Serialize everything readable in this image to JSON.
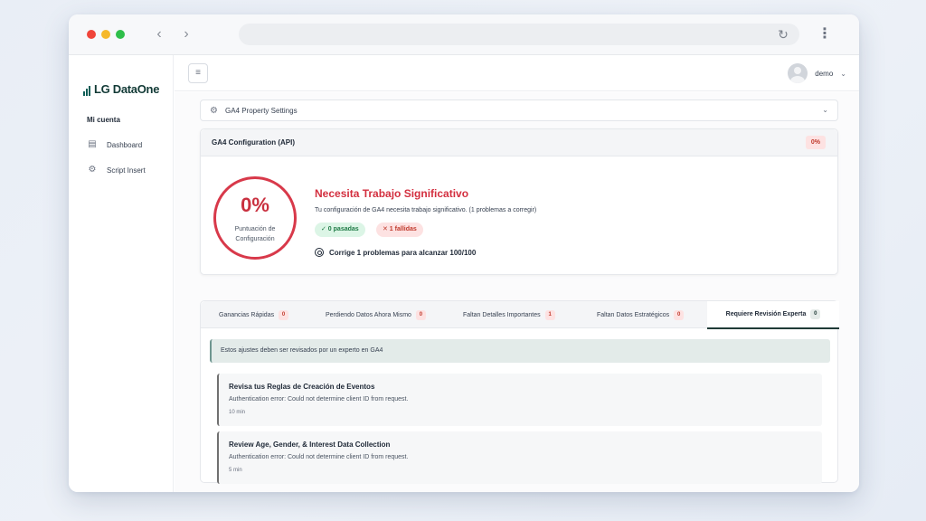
{
  "brand": {
    "name": "LG DataOne"
  },
  "sidebar": {
    "section_label": "Mi cuenta",
    "items": [
      {
        "label": "Dashboard",
        "icon": "table-icon"
      },
      {
        "label": "Script Insert",
        "icon": "gear-icon"
      }
    ]
  },
  "topbar": {
    "user_name": "demo"
  },
  "property_settings": {
    "label": "GA4 Property Settings"
  },
  "config": {
    "title": "GA4 Configuration (API)",
    "badge": "0%",
    "score_value": "0%",
    "score_label": "Puntuación de Configuración",
    "status_title": "Necesita Trabajo Significativo",
    "status_desc": "Tu configuración de GA4 necesita trabajo significativo. (1 problemas a corregir)",
    "passed_label": "✓ 0 pasadas",
    "failed_label": "✕ 1 fallidas",
    "fix_hint": "Corrige 1 problemas para alcanzar 100/100"
  },
  "tabs": [
    {
      "label": "Ganancias Rápidas",
      "count": "0"
    },
    {
      "label": "Perdiendo Datos Ahora Mismo",
      "count": "0"
    },
    {
      "label": "Faltan Detalles Importantes",
      "count": "1"
    },
    {
      "label": "Faltan Datos Estratégicos",
      "count": "0"
    },
    {
      "label": "Requiere Revisión Experta",
      "count": "0",
      "active": true
    }
  ],
  "info_banner": "Estos ajustes deben ser revisados por un experto en GA4",
  "rules": [
    {
      "title": "Revisa tus Reglas de Creación de Eventos",
      "error": "Authentication error: Could not determine client ID from request.",
      "time": "10 min"
    },
    {
      "title": "Review Age, Gender, & Interest Data Collection",
      "error": "Authentication error: Could not determine client ID from request.",
      "time": "5 min"
    }
  ],
  "colors": {
    "danger": "#d32f3f",
    "success": "#1e7a45",
    "brand": "#0d5d56"
  }
}
